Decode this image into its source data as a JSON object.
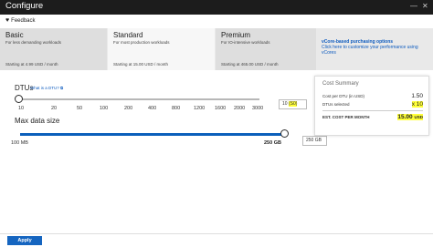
{
  "window": {
    "title": "Configure",
    "minimize_glyph": "—",
    "close_glyph": "✕"
  },
  "feedback": {
    "icon": "heart-icon",
    "label": "Feedback"
  },
  "tiers": [
    {
      "name": "Basic",
      "desc": "For less demanding workloads",
      "price": "Starting at 4.99 USD / month",
      "selected": false
    },
    {
      "name": "Standard",
      "desc": "For most production workloads",
      "price": "Starting at 15.00 USD / month",
      "selected": true
    },
    {
      "name": "Premium",
      "desc": "For IO-intensive workloads",
      "price": "Starting at 465.00 USD / month",
      "selected": false
    }
  ],
  "vcore": {
    "title": "vCore-based purchasing options",
    "text": "Click here to customize your performance using vCores"
  },
  "dtu": {
    "label": "DTUs",
    "help_link": "What is a DTU?",
    "ticks": [
      "10",
      "20",
      "50",
      "100",
      "200",
      "400",
      "800",
      "1200",
      "1600",
      "2000",
      "3000"
    ],
    "value_prefix": "10",
    "value_highlight": "(S0)",
    "selected_value": 10
  },
  "max_data": {
    "label": "Max data size",
    "min_label": "100 MB",
    "max_label": "250 GB",
    "input_value": "250 GB",
    "selected_fraction": 1.0
  },
  "cost_summary": {
    "title": "Cost Summary",
    "cost_label": "Cost per DTU (in USD)",
    "cost_value": "1.50",
    "dtus_label": "DTUs selected",
    "dtus_value": "x 10",
    "est_label": "EST. COST PER MONTH",
    "est_value": "15.00",
    "est_unit": "USD"
  },
  "apply_label": "Apply",
  "colors": {
    "accent": "#0b5fbb",
    "highlight": "#ffff3a",
    "titlebar": "#1c1c1c"
  }
}
